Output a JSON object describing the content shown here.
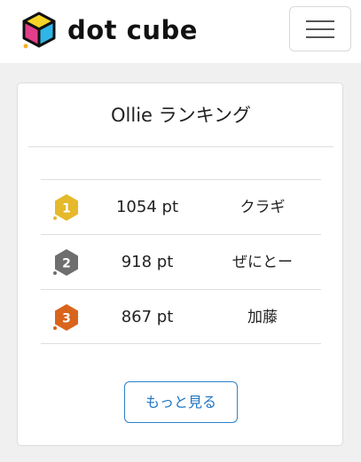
{
  "header": {
    "brand_name": "dot cube",
    "logo_icon": "dot-cube-logo-icon",
    "menu_icon": "hamburger-menu-icon"
  },
  "ranking": {
    "title": "Ollie ランキング",
    "rows": [
      {
        "rank": "1",
        "score": "1054 pt",
        "player": "クラギ",
        "badge_color": "#e5b92b"
      },
      {
        "rank": "2",
        "score": "918 pt",
        "player": "ぜにとー",
        "badge_color": "#6e6e6e"
      },
      {
        "rank": "3",
        "score": "867 pt",
        "player": "加藤",
        "badge_color": "#d9641c"
      }
    ],
    "more_button": "もっと見る"
  },
  "colors": {
    "accent": "#1f75c4",
    "gold": "#e5b92b",
    "silver": "#6e6e6e",
    "bronze": "#d9641c"
  }
}
